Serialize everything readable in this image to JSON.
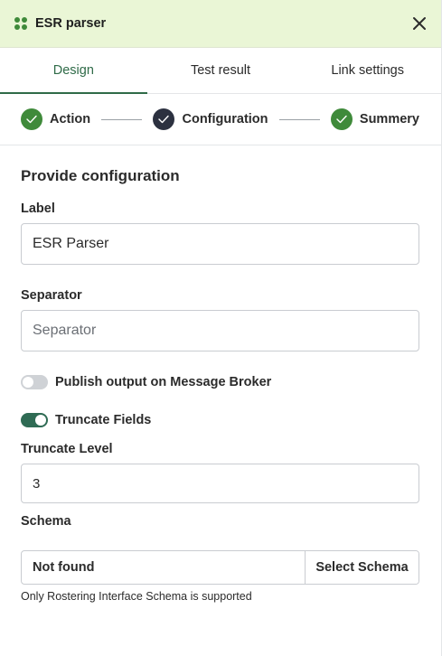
{
  "header": {
    "title": "ESR parser"
  },
  "tabs": [
    {
      "label": "Design",
      "active": true
    },
    {
      "label": "Test result",
      "active": false
    },
    {
      "label": "Link settings",
      "active": false
    }
  ],
  "steps": [
    {
      "label": "Action",
      "state": "done"
    },
    {
      "label": "Configuration",
      "state": "current"
    },
    {
      "label": "Summery",
      "state": "done"
    }
  ],
  "form": {
    "section_title": "Provide configuration",
    "label": {
      "label": "Label",
      "value": "ESR Parser"
    },
    "separator": {
      "label": "Separator",
      "placeholder": "Separator",
      "value": ""
    },
    "publish_toggle": {
      "label": "Publish output on Message Broker",
      "on": false
    },
    "truncate_toggle": {
      "label": "Truncate Fields",
      "on": true
    },
    "truncate_level": {
      "label": "Truncate Level",
      "value": "3"
    },
    "schema": {
      "label": "Schema",
      "value": "Not found",
      "button": "Select Schema",
      "hint": "Only Rostering Interface Schema is supported"
    }
  },
  "colors": {
    "accent": "#2f6b48",
    "header_bg": "#eaf6d6",
    "step_done": "#3f8a3a",
    "step_current": "#2c3140",
    "toggle_on": "#2f6b54",
    "toggle_off": "#cfd2d6"
  },
  "icons": {
    "app": "app-grid-icon",
    "close": "close-icon",
    "check": "check-icon"
  }
}
